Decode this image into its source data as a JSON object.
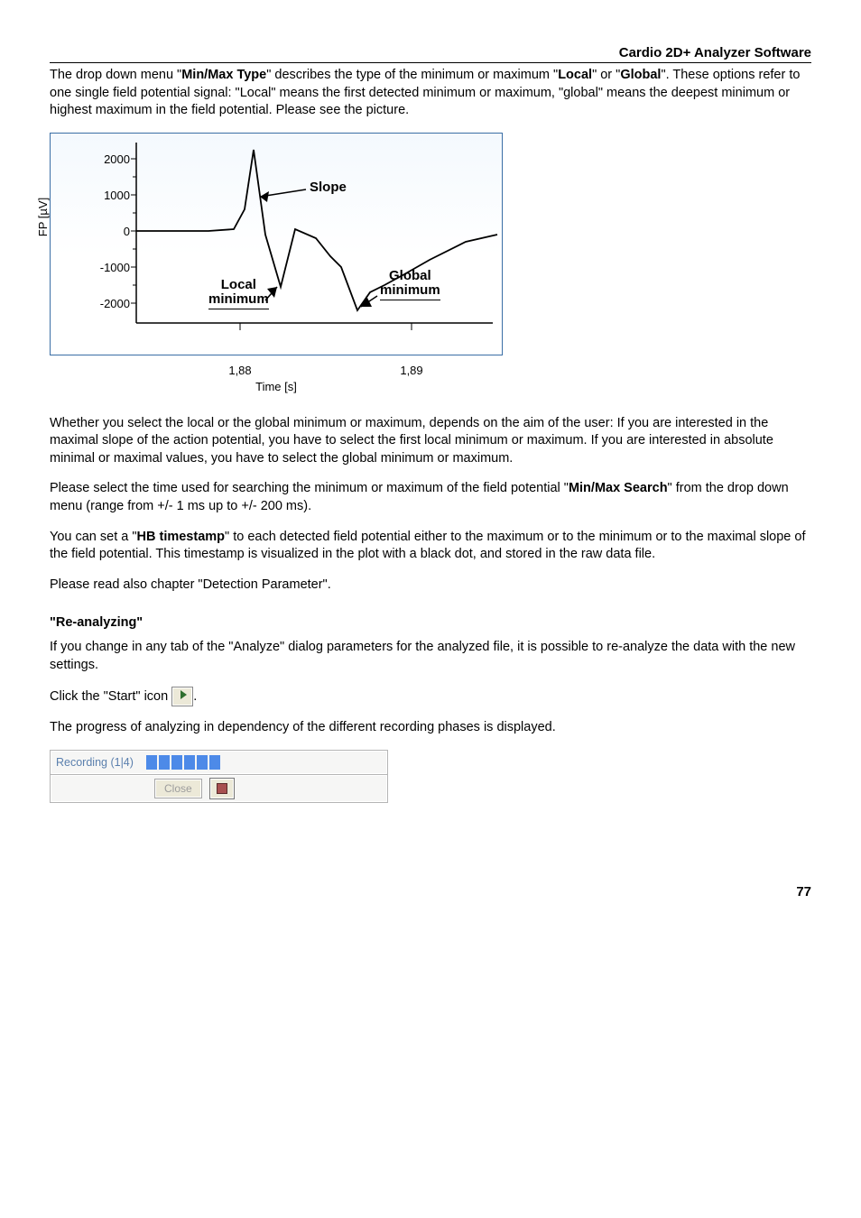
{
  "header": {
    "title": "Cardio 2D+ Analyzer Software"
  },
  "para1": {
    "t1": "The drop down menu \"",
    "b1": "Min/Max Type",
    "t2": "\" describes the type of the minimum or maximum \"",
    "b2": "Local",
    "t3": "\" or \"",
    "b3": "Global",
    "t4": "\". These options refer to one single field potential signal: \"Local\" means the first detected minimum or maximum, \"global\" means the deepest minimum or highest maximum in the field potential. Please see the picture."
  },
  "chart_data": {
    "type": "line",
    "title": "",
    "xlabel": "Time [s]",
    "ylabel": "FP [µV]",
    "ylim": [
      -2400,
      2400
    ],
    "xlim_labels": [
      "1,88",
      "1,89"
    ],
    "yticks": [
      2000,
      1000,
      0,
      -1000,
      -2000
    ],
    "annotations": [
      "Slope",
      "Local minimum",
      "Global minimum"
    ],
    "series": [
      {
        "name": "FP",
        "x_norm": [
          0.0,
          0.1,
          0.2,
          0.27,
          0.3,
          0.33,
          0.36,
          0.405,
          0.445,
          0.5,
          0.54,
          0.57,
          0.62,
          0.65,
          0.69,
          0.75,
          0.82,
          0.92,
          1.0
        ],
        "y": [
          0,
          0,
          0,
          50,
          600,
          2250,
          -100,
          -1550,
          50,
          -200,
          -700,
          -1000,
          -2200,
          -1700,
          -1500,
          -1200,
          -800,
          -300,
          -100
        ]
      }
    ],
    "markers": [
      {
        "label": "Slope",
        "x_norm": 0.345,
        "y": 1100
      },
      {
        "label": "Local minimum",
        "x_norm": 0.405,
        "y": -1550
      },
      {
        "label": "Global minimum",
        "x_norm": 0.62,
        "y": -2200
      }
    ]
  },
  "para2": "Whether you select the local or the global minimum or maximum, depends on the aim of the user: If you are interested in the maximal slope of the action potential, you have to select the first local minimum or maximum. If you are interested in absolute minimal or maximal values, you have to select the global minimum or maximum.",
  "para3": {
    "t1": "Please select the time used for searching the minimum or maximum of the field potential \"",
    "b1": "Min/Max Search",
    "t2": "\" from the drop down menu (range from +/- 1 ms up to +/- 200 ms)."
  },
  "para4": {
    "t1": "You can set a \"",
    "b1": "HB timestamp",
    "t2": "\" to each detected field potential either to the maximum or to the minimum or to the maximal slope of the field potential. This timestamp is visualized in the plot with a black dot, and stored in the raw data file."
  },
  "para5": "Please read also chapter \"Detection Parameter\".",
  "sec_head": "\"Re-analyzing\"",
  "para6": "If you change in any tab of the  \"Analyze\" dialog parameters for the analyzed file, it is possible to re-analyze the data with the new settings.",
  "para7a": "Click the \"Start\" icon ",
  "para7b": ".",
  "para8": "The progress of analyzing in dependency of the different recording phases is displayed.",
  "progress": {
    "label": "Recording (1|4)",
    "close_label": "Close"
  },
  "pagenum": "77"
}
